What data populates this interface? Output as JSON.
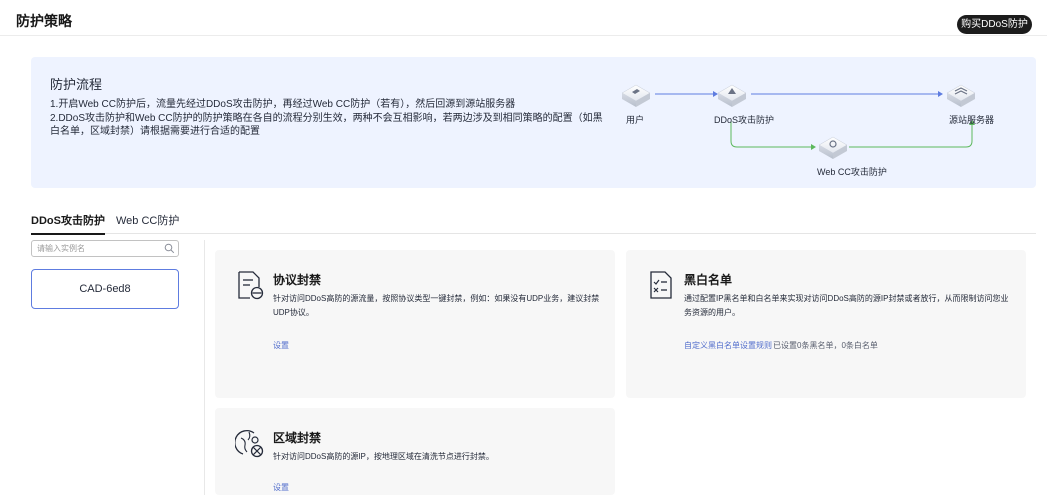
{
  "header": {
    "title": "防护策略",
    "buy_button": "购买DDoS防护"
  },
  "flow": {
    "title": "防护流程",
    "lines": [
      "1.开启Web CC防护后，流量先经过DDoS攻击防护，再经过Web CC防护（若有），然后回源到源站服务器",
      "2.DDoS攻击防护和Web CC防护的防护策略在各自的流程分别生效，两种不会互相影响，若两边涉及到相同策略的配置（如黑白名单，区域封禁）请根据需要进行合适的配置"
    ],
    "nodes": {
      "user": "用户",
      "ddos": "DDoS攻击防护",
      "origin": "源站服务器",
      "webcc": "Web CC攻击防护"
    },
    "colors": {
      "blue": "#5e7ce0",
      "green": "#5cb85c"
    }
  },
  "tabs": [
    {
      "label": "DDoS攻击防护",
      "active": true
    },
    {
      "label": "Web CC防护",
      "active": false
    }
  ],
  "instance_search": {
    "placeholder": "请输入实例名",
    "value": ""
  },
  "instances": [
    {
      "name": "CAD-6ed8",
      "selected": true
    }
  ],
  "cards": {
    "protocol": {
      "title": "协议封禁",
      "icon": "document-block-icon",
      "desc": "针对访问DDoS高防的源流量，按照协议类型一键封禁，例如：如果没有UDP业务，建议封禁UDP协议。",
      "link": "设置"
    },
    "blacklist": {
      "title": "黑白名单",
      "icon": "checklist-document-icon",
      "desc": "通过配置IP黑名单和白名单来实现对访问DDoS高防的源IP封禁或者放行，从而限制访问您业务资源的用户。",
      "link": "自定义黑白名单设置规则",
      "stat": "已设置0条黑名单，0条白名单"
    },
    "region": {
      "title": "区域封禁",
      "icon": "globe-block-icon",
      "desc": "针对访问DDoS高防的源IP，按地理区域在清洗节点进行封禁。",
      "link": "设置"
    }
  }
}
